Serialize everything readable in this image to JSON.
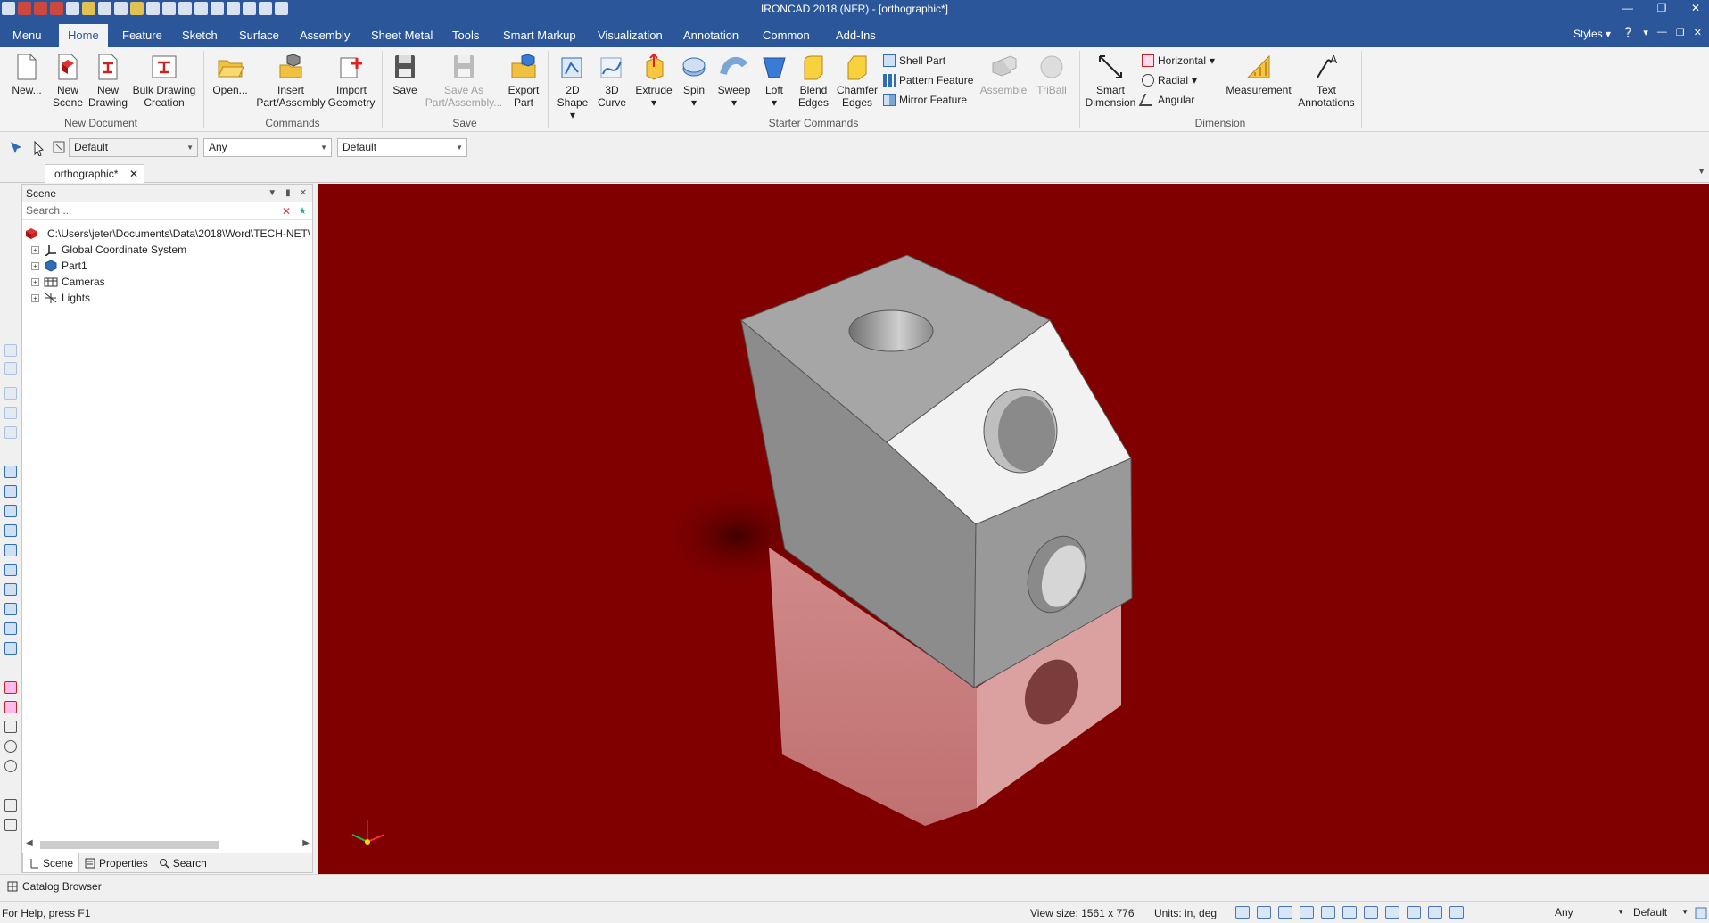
{
  "app": {
    "window_title": "IRONCAD 2018 (NFR) - [orthographic*]"
  },
  "tabs": [
    "Menu",
    "Home",
    "Feature",
    "Sketch",
    "Surface",
    "Assembly",
    "Sheet Metal",
    "Tools",
    "Smart Markup",
    "Visualization",
    "Annotation",
    "Common",
    "Add-Ins"
  ],
  "active_tab": "Home",
  "styles_label": "Styles",
  "ribbon": {
    "new": "New...",
    "new_scene_1": "New",
    "new_scene_2": "Scene",
    "new_drawing_1": "New",
    "new_drawing_2": "Drawing",
    "bulk_1": "Bulk Drawing",
    "bulk_2": "Creation",
    "group_new_document": "New Document",
    "open": "Open...",
    "insert_1": "Insert",
    "insert_2": "Part/Assembly",
    "import_1": "Import",
    "import_2": "Geometry",
    "group_commands": "Commands",
    "save": "Save",
    "saveas_1": "Save As",
    "saveas_2": "Part/Assembly...",
    "export_1": "Export",
    "export_2": "Part",
    "group_save": "Save",
    "shape2d_1": "2D",
    "shape2d_2": "Shape",
    "curve3d_1": "3D",
    "curve3d_2": "Curve",
    "extrude": "Extrude",
    "spin": "Spin",
    "sweep": "Sweep",
    "loft": "Loft",
    "blend_1": "Blend",
    "blend_2": "Edges",
    "chamfer_1": "Chamfer",
    "chamfer_2": "Edges",
    "shell_part": "Shell Part",
    "pattern_feature": "Pattern Feature",
    "mirror_feature": "Mirror Feature",
    "assemble": "Assemble",
    "triball": "TriBall",
    "group_starter": "Starter Commands",
    "smart_dim_1": "Smart",
    "smart_dim_2": "Dimension",
    "horizontal": "Horizontal",
    "radial": "Radial",
    "angular": "Angular",
    "measurement": "Measurement",
    "text_ann_1": "Text",
    "text_ann_2": "Annotations",
    "group_dimension": "Dimension"
  },
  "toolbar": {
    "combo1": "Default",
    "combo2": "Any",
    "combo3": "Default"
  },
  "document_tab": "orthographic*",
  "scene_panel": {
    "title": "Scene",
    "search_placeholder": "Search ...",
    "root_path": "C:\\Users\\jeter\\Documents\\Data\\2018\\Word\\TECH-NET\\",
    "items": [
      "Global Coordinate System",
      "Part1",
      "Cameras",
      "Lights"
    ],
    "bottom_tabs": [
      "Scene",
      "Properties",
      "Search"
    ]
  },
  "catalog_browser": "Catalog Browser",
  "status": {
    "help": "For Help, press F1",
    "view_size": "View size: 1561 x 776",
    "units": "Units: in, deg",
    "combo_any": "Any",
    "combo_default": "Default"
  },
  "colors": {
    "ribbon_blue": "#2b579a",
    "viewport_bg": "#800000"
  }
}
